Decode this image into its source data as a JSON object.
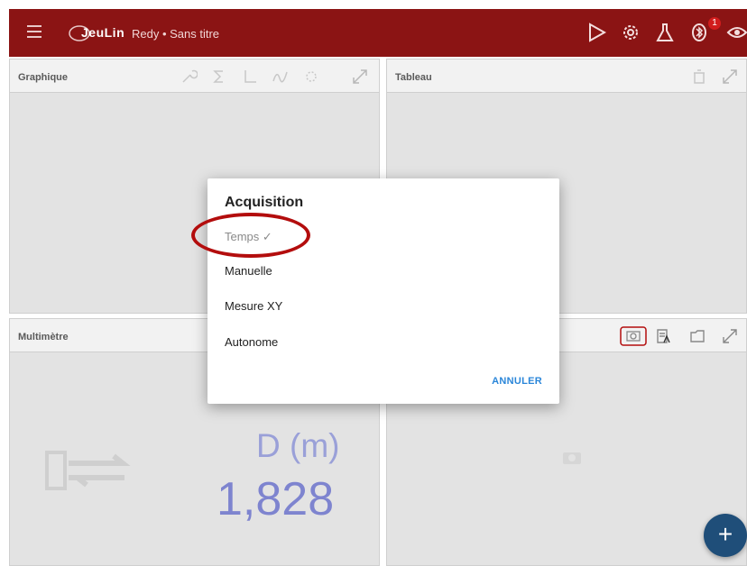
{
  "appbar": {
    "logo_text": "JeuLin",
    "title": "Redy • Sans titre",
    "badge_count": "1"
  },
  "panels": {
    "graph": {
      "label": "Graphique"
    },
    "table": {
      "label": "Tableau"
    },
    "multimeter": {
      "label": "Multimètre",
      "quantity": "D (m)",
      "value": "1,828"
    }
  },
  "dialog": {
    "title": "Acquisition",
    "options": [
      {
        "label": "Temps ✓",
        "selected": true
      },
      {
        "label": "Manuelle",
        "selected": false
      },
      {
        "label": "Mesure XY",
        "selected": false
      },
      {
        "label": "Autonome",
        "selected": false
      }
    ],
    "cancel_label": "ANNULER"
  },
  "fab": {
    "label": "+"
  },
  "colors": {
    "appbar": "#8b1414",
    "accent_blue": "#2a86d9",
    "highlight_ring": "#b30d0d",
    "fab": "#1f4e79"
  }
}
